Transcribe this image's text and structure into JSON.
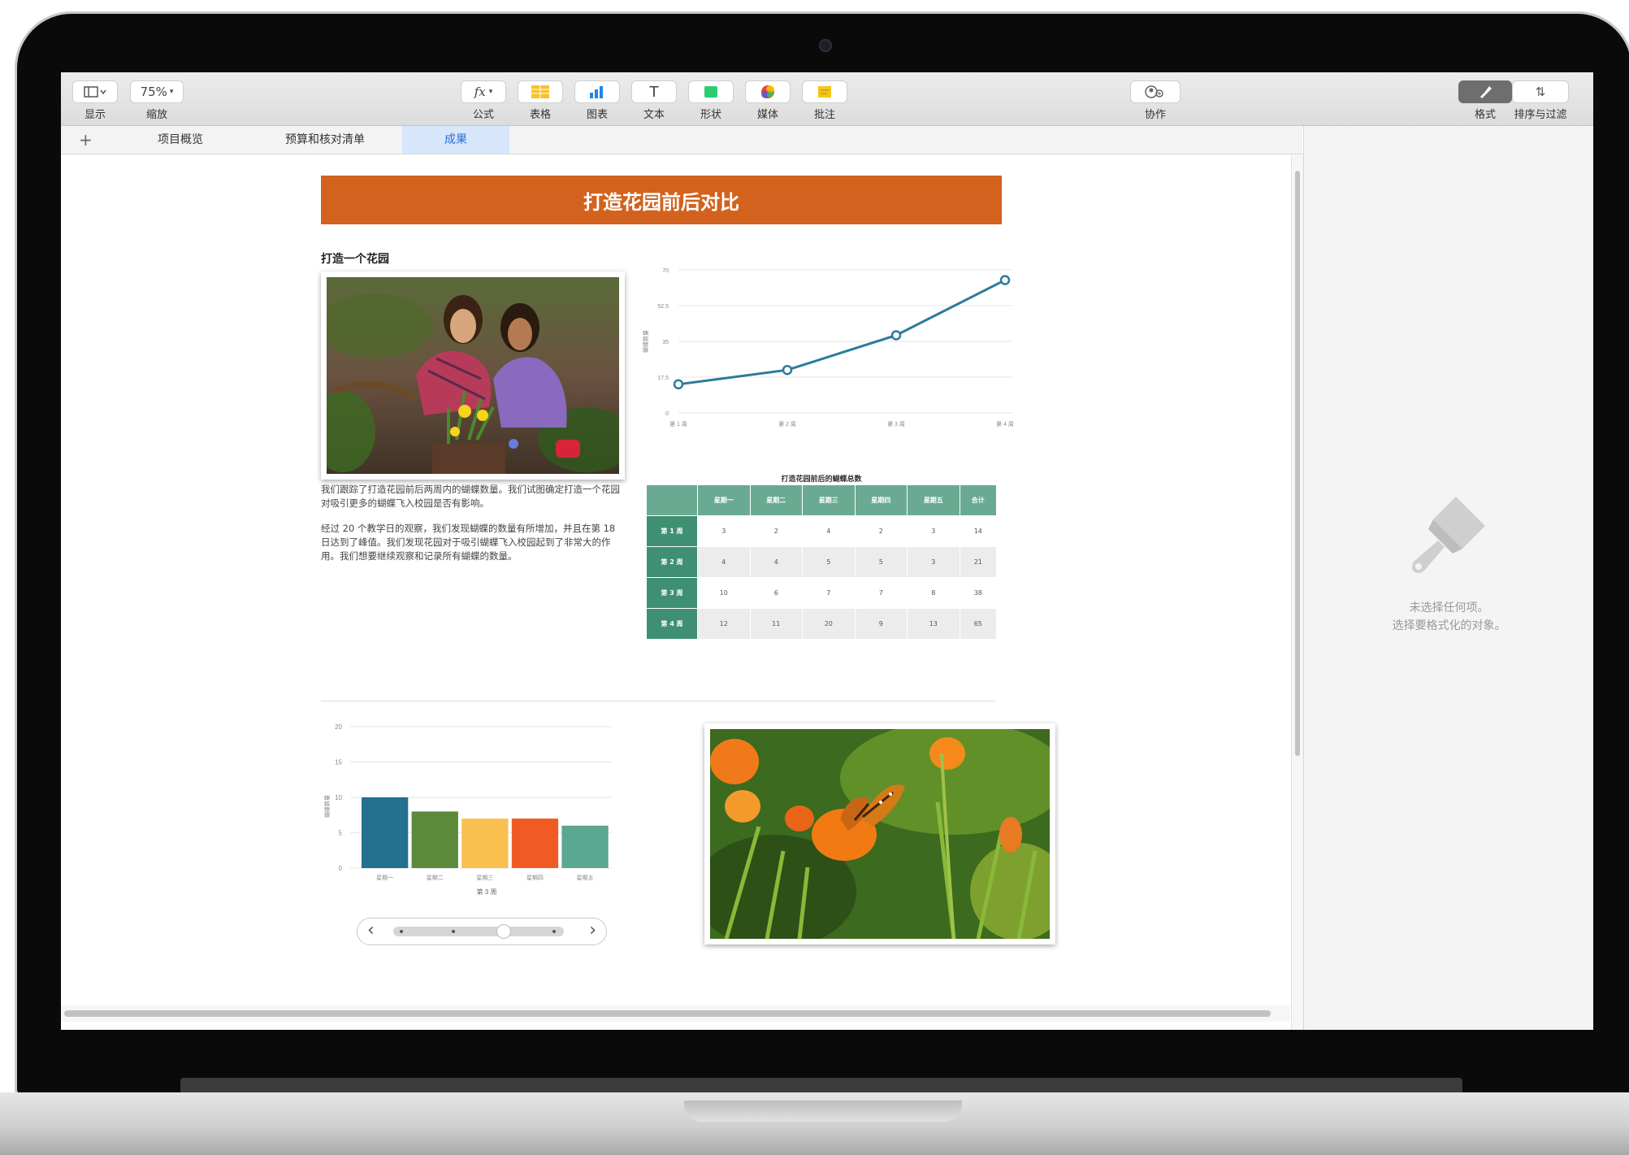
{
  "toolbar": {
    "view_label": "显示",
    "zoom_value": "75%",
    "zoom_label": "缩放",
    "formula_btn": "fx",
    "formula_label": "公式",
    "table_label": "表格",
    "chart_label": "图表",
    "text_btn": "T",
    "text_label": "文本",
    "shape_label": "形状",
    "media_label": "媒体",
    "comment_label": "批注",
    "collab_label": "协作",
    "format_label": "格式",
    "sort_label": "排序与过滤"
  },
  "tabs": {
    "add": "+",
    "items": [
      "项目概览",
      "预算和核对清单",
      "成果"
    ],
    "active_index": 2
  },
  "sidebar": {
    "line1": "未选择任何项。",
    "line2": "选择要格式化的对象。"
  },
  "document": {
    "title": "打造花园前后对比",
    "subtitle": "打造一个花园",
    "para1": "我们跟踪了打造花园前后两周内的蝴蝶数量。我们试图确定打造一个花园对吸引更多的蝴蝶飞入校园是否有影响。",
    "para2": "经过 20 个教学日的观察，我们发现蝴蝶的数量有所增加，并且在第 18 日达到了峰值。我们发现花园对于吸引蝴蝶飞入校园起到了非常大的作用。我们想要继续观察和记录所有蝴蝶的数量。",
    "colors": {
      "title_bar": "#d2621d",
      "line": "#2b7b9b",
      "table_header": "#6aaa93",
      "table_row_header": "#3f8f73"
    }
  },
  "table": {
    "title": "打造花园前后的蝴蝶总数",
    "headers": [
      "",
      "星期一",
      "星期二",
      "星期三",
      "星期四",
      "星期五",
      "合计"
    ],
    "rows": [
      [
        "第 1 周",
        "3",
        "2",
        "4",
        "2",
        "3",
        "14"
      ],
      [
        "第 2 周",
        "4",
        "4",
        "5",
        "5",
        "3",
        "21"
      ],
      [
        "第 3 周",
        "10",
        "6",
        "7",
        "7",
        "8",
        "38"
      ],
      [
        "第 4 周",
        "12",
        "11",
        "20",
        "9",
        "13",
        "65"
      ]
    ]
  },
  "chart_data": [
    {
      "type": "line",
      "x": [
        "第 1 周",
        "第 2 周",
        "第 3 周",
        "第 4 周"
      ],
      "series": [
        {
          "values": [
            14,
            21,
            38,
            65
          ]
        }
      ],
      "yticks": [
        "0",
        "17.5",
        "35",
        "52.5",
        "70"
      ],
      "ylabel": "蝴蝶数量",
      "ylim": [
        0,
        70
      ]
    },
    {
      "type": "bar",
      "categories": [
        "星期一",
        "星期二",
        "星期三",
        "星期四",
        "星期五"
      ],
      "values": [
        10,
        8,
        7,
        7,
        6
      ],
      "colors": [
        "#23708f",
        "#5b8a3a",
        "#f9c04f",
        "#f05a23",
        "#5aa792"
      ],
      "yticks": [
        "0",
        "5",
        "10",
        "15",
        "20"
      ],
      "xlabel": "第 3 周",
      "ylabel": "蝴蝶数量",
      "ylim": [
        0,
        20
      ]
    }
  ],
  "pager": {
    "prev": "‹",
    "next": "›"
  }
}
